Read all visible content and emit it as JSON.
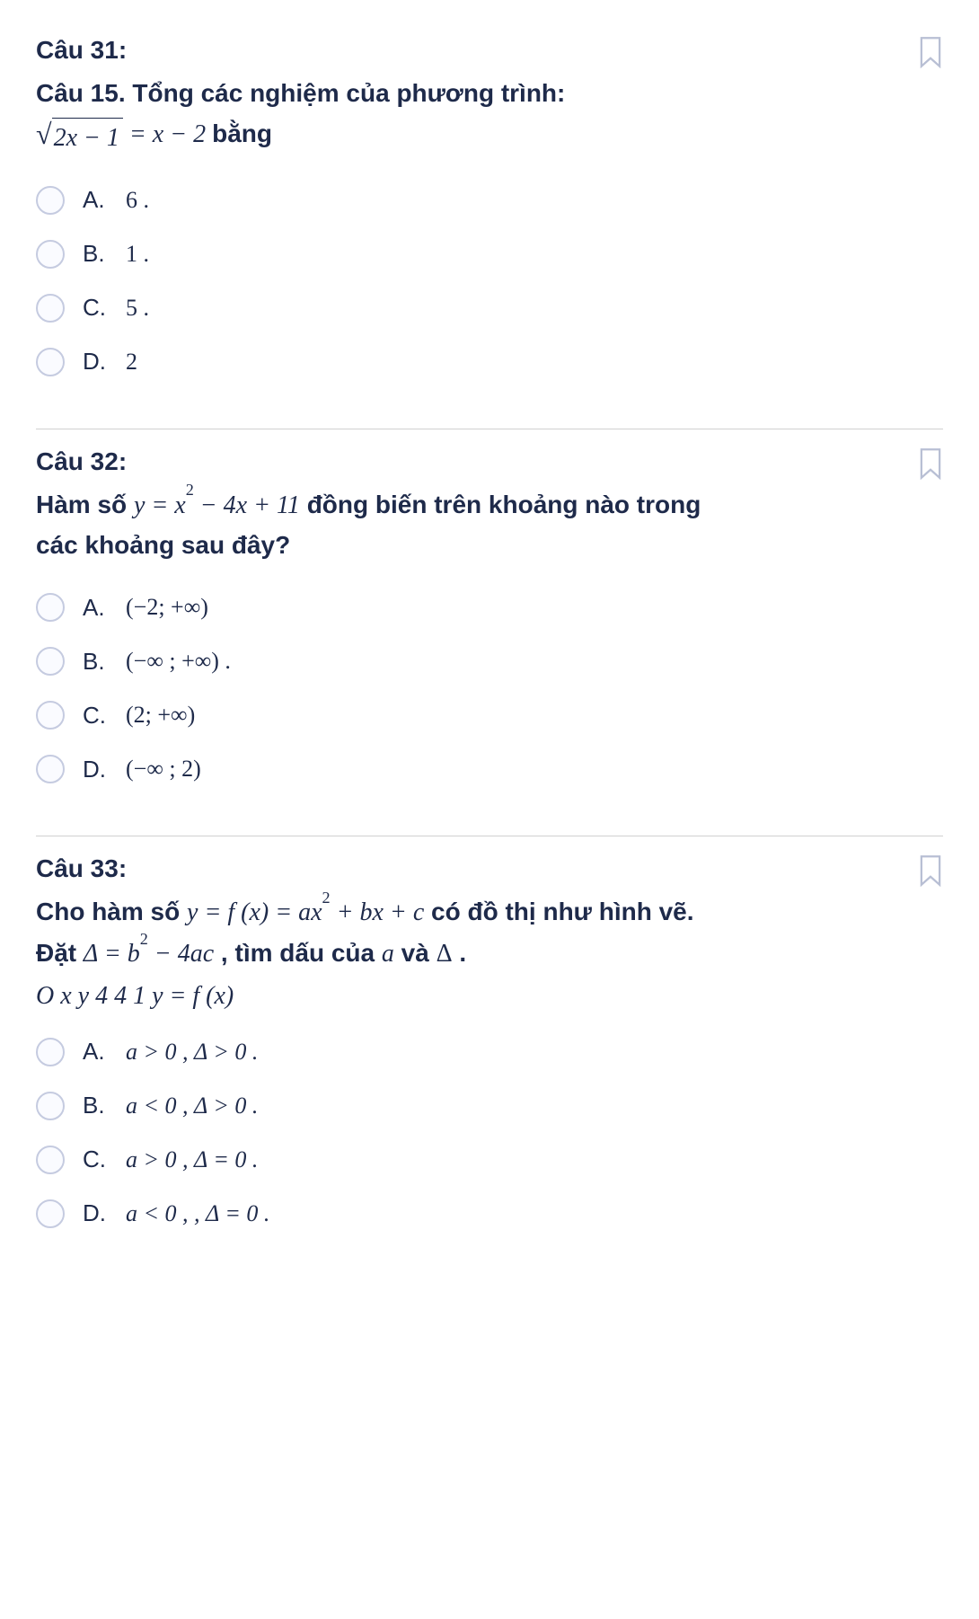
{
  "questions": [
    {
      "number": "Câu 31:",
      "prompt_parts": {
        "line1_prefix": "Câu 15. ",
        "line1_text": "Tổng các nghiệm của phương trình:",
        "equation_lhs_radicand": "2x − 1",
        "equation_rhs": " = x − 2",
        "line2_suffix": " bằng"
      },
      "options": [
        {
          "letter": "A.",
          "text": "6 ."
        },
        {
          "letter": "B.",
          "text": "1 ."
        },
        {
          "letter": "C.",
          "text": "5 ."
        },
        {
          "letter": "D.",
          "text": "2"
        }
      ]
    },
    {
      "number": "Câu 32:",
      "prompt_parts": {
        "t1": "Hàm số ",
        "eq": "y = x",
        "eq_sup": "2",
        "eq_tail": " − 4x + 11",
        "t2": " đồng biến trên khoảng nào trong các khoảng sau đây?"
      },
      "options": [
        {
          "letter": "A.",
          "text": "(−2; +∞)"
        },
        {
          "letter": "B.",
          "text": "(−∞ ; +∞) ."
        },
        {
          "letter": "C.",
          "text": "(2; +∞)"
        },
        {
          "letter": "D.",
          "text": "(−∞ ; 2)"
        }
      ]
    },
    {
      "number": "Câu 33:",
      "prompt_parts": {
        "t1": "Cho hàm số ",
        "eq1": "y = f (x) = ax",
        "eq1_sup": "2",
        "eq1_tail": " + bx + c",
        "t2": " có đồ thị như hình vẽ. Đặt ",
        "eq2": "Δ = b",
        "eq2_sup": "2",
        "eq2_tail": " − 4ac",
        "t3": " , tìm dấu của ",
        "var_a": "a",
        "t4": " và ",
        "var_d": "Δ",
        "t5": " .",
        "extra": "O x y 4 4 1 y = f (x)"
      },
      "options": [
        {
          "letter": "A.",
          "text": "a > 0 , Δ > 0 ."
        },
        {
          "letter": "B.",
          "text": "a < 0 , Δ > 0 ."
        },
        {
          "letter": "C.",
          "text": "a > 0 , Δ = 0 ."
        },
        {
          "letter": "D.",
          "text": "a < 0 , , Δ = 0 ."
        }
      ]
    }
  ]
}
